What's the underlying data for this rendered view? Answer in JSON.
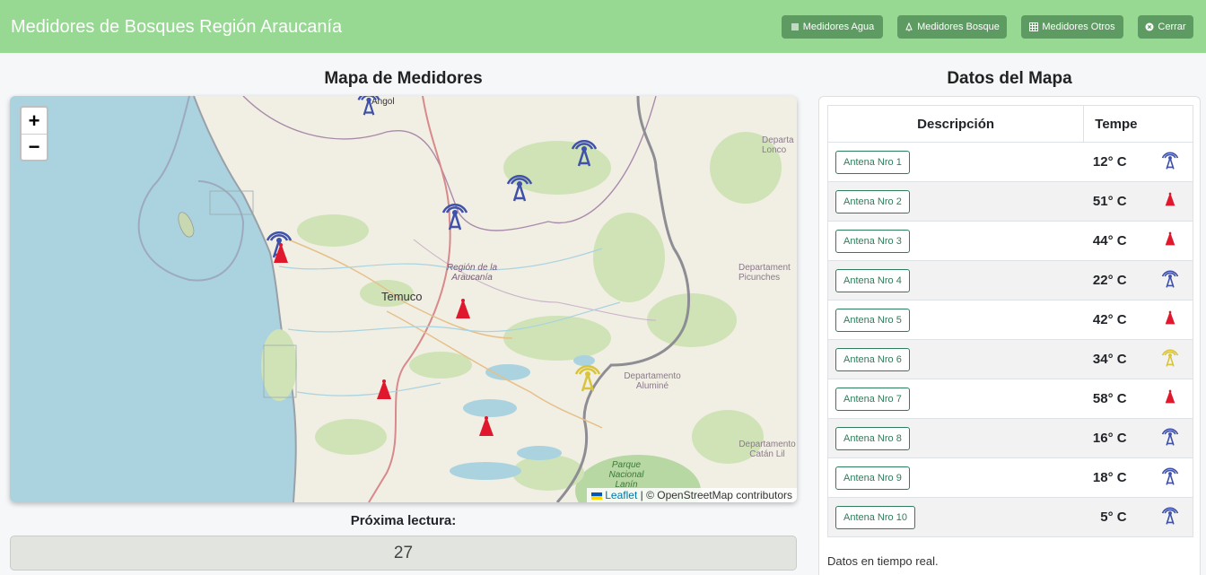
{
  "header": {
    "title": "Medidores de Bosques Región Araucanía",
    "nav": [
      {
        "label": "Medidores Agua",
        "icon": "water-icon"
      },
      {
        "label": "Medidores Bosque",
        "icon": "tree-icon"
      },
      {
        "label": "Medidores Otros",
        "icon": "grid-icon"
      },
      {
        "label": "Cerrar",
        "icon": "close-circle-icon"
      }
    ]
  },
  "map_section": {
    "title": "Mapa de Medidores",
    "zoom_in": "+",
    "zoom_out": "−",
    "labels": {
      "angol": "Angol",
      "temuco": "Temuco",
      "region": "Región de la Araucanía",
      "depto_lonco": "Departa Lonco",
      "depto_picunches": "Departament Picunches",
      "depto_alumine": "Departamento Aluminé",
      "depto_catan": "Departamento Catán Lil",
      "parque": "Parque Nacional Lanín"
    },
    "attribution": {
      "leaflet": "Leaflet",
      "rest": "| © OpenStreetMap contributors"
    },
    "next_reading_label": "Próxima lectura:",
    "next_reading_value": "27"
  },
  "data_section": {
    "title": "Datos del Mapa",
    "columns": [
      "Descripción",
      "Tempe"
    ],
    "rows": [
      {
        "name": "Antena Nro 1",
        "temp": "12° C",
        "icon": "antenna-blue-icon"
      },
      {
        "name": "Antena Nro 2",
        "temp": "51° C",
        "icon": "red-cone-icon"
      },
      {
        "name": "Antena Nro 3",
        "temp": "44° C",
        "icon": "red-cone-icon"
      },
      {
        "name": "Antena Nro 4",
        "temp": "22° C",
        "icon": "antenna-blue-icon"
      },
      {
        "name": "Antena Nro 5",
        "temp": "42° C",
        "icon": "red-cone-icon"
      },
      {
        "name": "Antena Nro 6",
        "temp": "34° C",
        "icon": "antenna-yellow-icon"
      },
      {
        "name": "Antena Nro 7",
        "temp": "58° C",
        "icon": "red-cone-icon"
      },
      {
        "name": "Antena Nro 8",
        "temp": "16° C",
        "icon": "antenna-blue-icon"
      },
      {
        "name": "Antena Nro 9",
        "temp": "18° C",
        "icon": "antenna-blue-icon"
      },
      {
        "name": "Antena Nro 10",
        "temp": "5° C",
        "icon": "antenna-blue-icon"
      }
    ],
    "footer": "Datos en tiempo real."
  },
  "colors": {
    "navbar": "#97d893",
    "nav_button": "#5e9b62",
    "antenna_blue": "#3f51a8",
    "antenna_yellow": "#d8c43a",
    "cone_red": "#e0182d"
  }
}
